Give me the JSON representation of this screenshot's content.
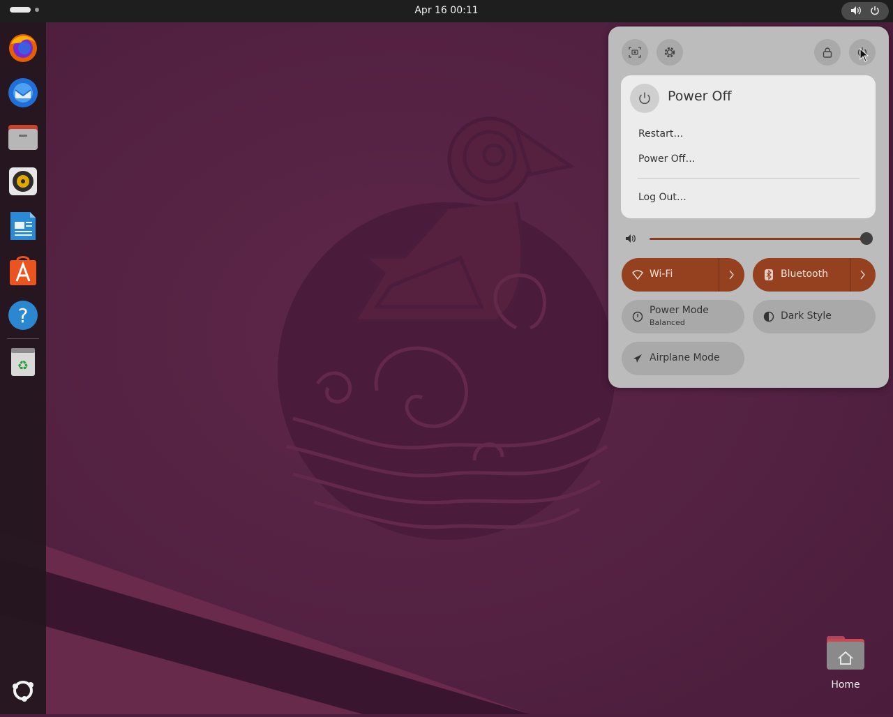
{
  "topbar": {
    "clock": "Apr 16  00:11",
    "activities_icon": "workspace-indicator",
    "status_icons": [
      "volume-icon",
      "power-icon"
    ]
  },
  "dock": {
    "items": [
      {
        "name": "firefox",
        "icon": "firefox-icon"
      },
      {
        "name": "thunderbird",
        "icon": "thunderbird-icon"
      },
      {
        "name": "files",
        "icon": "files-icon"
      },
      {
        "name": "rhythmbox",
        "icon": "rhythmbox-icon"
      },
      {
        "name": "libreoffice-writer",
        "icon": "writer-icon"
      },
      {
        "name": "app-center",
        "icon": "app-center-icon"
      },
      {
        "name": "help",
        "icon": "help-icon"
      },
      {
        "name": "trash",
        "icon": "trash-icon"
      }
    ],
    "show_apps_icon": "show-apps-icon"
  },
  "desktop": {
    "home_label": "Home"
  },
  "quick_settings": {
    "header_icons": [
      "screenshot-icon",
      "settings-icon",
      "lock-icon",
      "power-icon"
    ],
    "power_menu": {
      "title": "Power Off",
      "items": [
        "Restart…",
        "Power Off…",
        "Log Out…"
      ]
    },
    "volume": {
      "level": 1.0
    },
    "tiles": {
      "wifi": {
        "label": "Wi-Fi",
        "active": true
      },
      "bluetooth": {
        "label": "Bluetooth",
        "active": true
      },
      "power_mode": {
        "label": "Power Mode",
        "sub": "Balanced",
        "active": false
      },
      "dark_style": {
        "label": "Dark Style",
        "active": false
      },
      "airplane": {
        "label": "Airplane Mode",
        "active": false
      }
    }
  },
  "colors": {
    "accent": "#95401f",
    "wallpaper": "#5a2445",
    "panel": "#bcbcbc",
    "topbar": "#1e1e1e"
  }
}
